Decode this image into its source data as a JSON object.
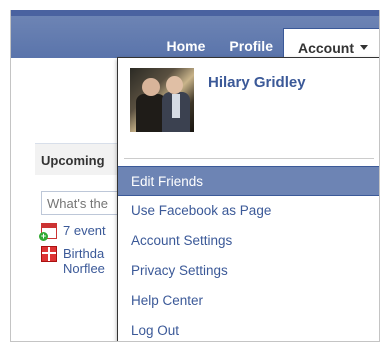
{
  "nav": {
    "home_label": "Home",
    "profile_label": "Profile",
    "account_label": "Account"
  },
  "background": {
    "upcoming_label": "Upcoming",
    "input_placeholder": "What's the",
    "events_text": "7 event",
    "birthday_line1": "Birthda",
    "birthday_line2": "Norflee"
  },
  "dropdown": {
    "profile_name": "Hilary Gridley",
    "items": [
      {
        "label": "Edit Friends",
        "active": true
      },
      {
        "label": "Use Facebook as Page"
      },
      {
        "label": "Account Settings"
      },
      {
        "label": "Privacy Settings"
      },
      {
        "label": "Help Center"
      },
      {
        "label": "Log Out"
      }
    ]
  },
  "colors": {
    "brand_blue": "#3b5998",
    "topbar": "#6d84b4",
    "highlight": "#6d84b4"
  },
  "icons": [
    "calendar-add-icon",
    "gift-icon",
    "chevron-down-icon"
  ]
}
